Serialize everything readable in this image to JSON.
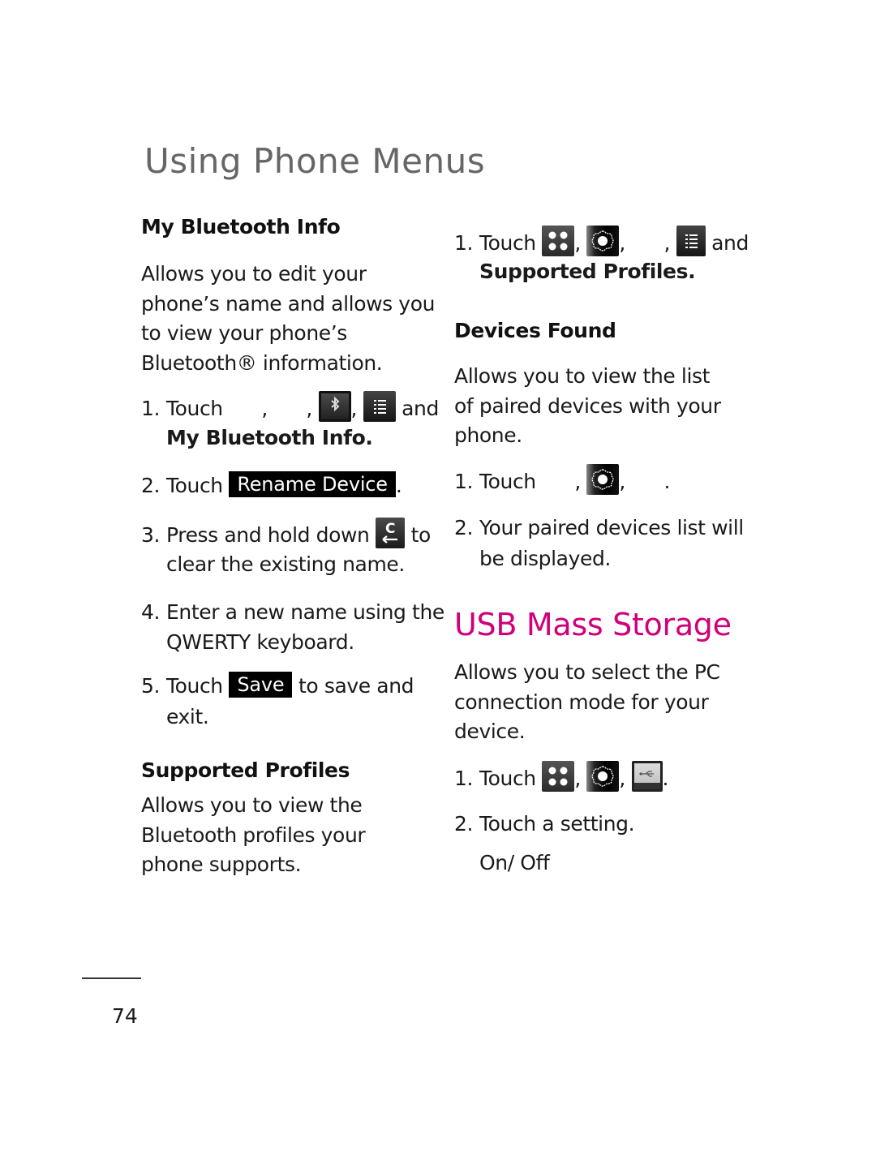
{
  "page": {
    "title": "Using Phone Menus",
    "number": "74"
  },
  "left": {
    "my_bt_info": {
      "heading": "My Bluetooth Info",
      "description": "Allows you to edit your phone’s name and allows you to view your phone’s Bluetooth® information.",
      "steps": [
        {
          "num": "1.",
          "text": "Touch",
          "sep1": ",",
          "sep2": ",",
          "sep3": ",",
          "after": "and",
          "target": "My Bluetooth Info."
        },
        {
          "num": "2.",
          "text": "Touch",
          "button": "Rename Device",
          "after": "."
        },
        {
          "num": "3.",
          "text": "Press and hold down",
          "after": "to",
          "line2": "clear the existing name."
        },
        {
          "num": "4.",
          "text": "Enter a new name using the",
          "line2": "QWERTY keyboard."
        },
        {
          "num": "5.",
          "text": "Touch",
          "button": "Save",
          "after": "to save and",
          "line2": "exit."
        }
      ]
    },
    "supported_profiles": {
      "heading": "Supported Profiles",
      "description": "Allows you to view the Bluetooth profiles your phone supports."
    }
  },
  "right": {
    "profiles_step": {
      "num": "1.",
      "text": "Touch",
      "sep1": ",",
      "sep2": ",",
      "sep3": ",",
      "after": "and",
      "target": "Supported Profiles."
    },
    "devices_found": {
      "heading": "Devices Found",
      "description": "Allows you to view the list of paired devices with your phone.",
      "steps": [
        {
          "num": "1.",
          "text": "Touch",
          "sep1": ",",
          "sep2": ",",
          "after": "."
        },
        {
          "num": "2.",
          "text": "Your paired devices list will",
          "line2": "be displayed."
        }
      ]
    },
    "usb": {
      "heading": "USB Mass Storage",
      "heading_color": "#d1007a",
      "description": "Allows you to select the PC connection mode for your device.",
      "steps": [
        {
          "num": "1.",
          "text": "Touch",
          "sep1": ",",
          "sep2": ",",
          "after": "."
        },
        {
          "num": "2.",
          "text": "Touch a setting."
        }
      ],
      "option": "On/ Off"
    }
  },
  "icons": {
    "apps": "apps-grid-icon",
    "settings": "settings-gear-icon",
    "bluetooth": "bluetooth-icon",
    "menu": "menu-list-icon",
    "clear": "clear-backspace-icon",
    "usb": "usb-icon"
  }
}
